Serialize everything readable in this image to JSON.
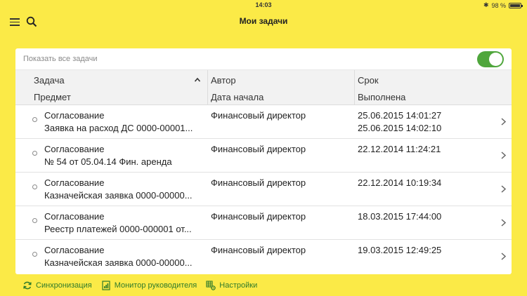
{
  "status": {
    "time": "14:03",
    "battery": "98 %"
  },
  "nav": {
    "title": "Мои задачи"
  },
  "filter": {
    "label": "Показать все задачи",
    "toggle_on": true
  },
  "columns": {
    "task": "Задача",
    "subject": "Предмет",
    "author": "Автор",
    "start_date": "Дата начала",
    "due": "Срок",
    "done": "Выполнена"
  },
  "rows": [
    {
      "task": "Согласование",
      "subject": "Заявка на расход ДС 0000-00001...",
      "author": "Финансовый директор",
      "due": "25.06.2015 14:01:27",
      "done": "25.06.2015 14:02:10"
    },
    {
      "task": "Согласование",
      "subject": "№ 54 от 05.04.14 Фин. аренда",
      "author": "Финансовый директор",
      "due": "22.12.2014 11:24:21",
      "done": ""
    },
    {
      "task": "Согласование",
      "subject": "Казначейская заявка 0000-00000...",
      "author": "Финансовый директор",
      "due": "22.12.2014 10:19:34",
      "done": ""
    },
    {
      "task": "Согласование",
      "subject": "Реестр платежей 0000-000001 от...",
      "author": "Финансовый директор",
      "due": "18.03.2015 17:44:00",
      "done": ""
    },
    {
      "task": "Согласование",
      "subject": "Казначейская заявка 0000-00000...",
      "author": "Финансовый директор",
      "due": "19.03.2015 12:49:25",
      "done": ""
    }
  ],
  "toolbar": {
    "sync": "Синхронизация",
    "monitor": "Монитор руководителя",
    "settings": "Настройки"
  },
  "colors": {
    "header_bg": "#fbea47",
    "accent_green": "#4fa63c",
    "link_green": "#2f7a2b"
  }
}
